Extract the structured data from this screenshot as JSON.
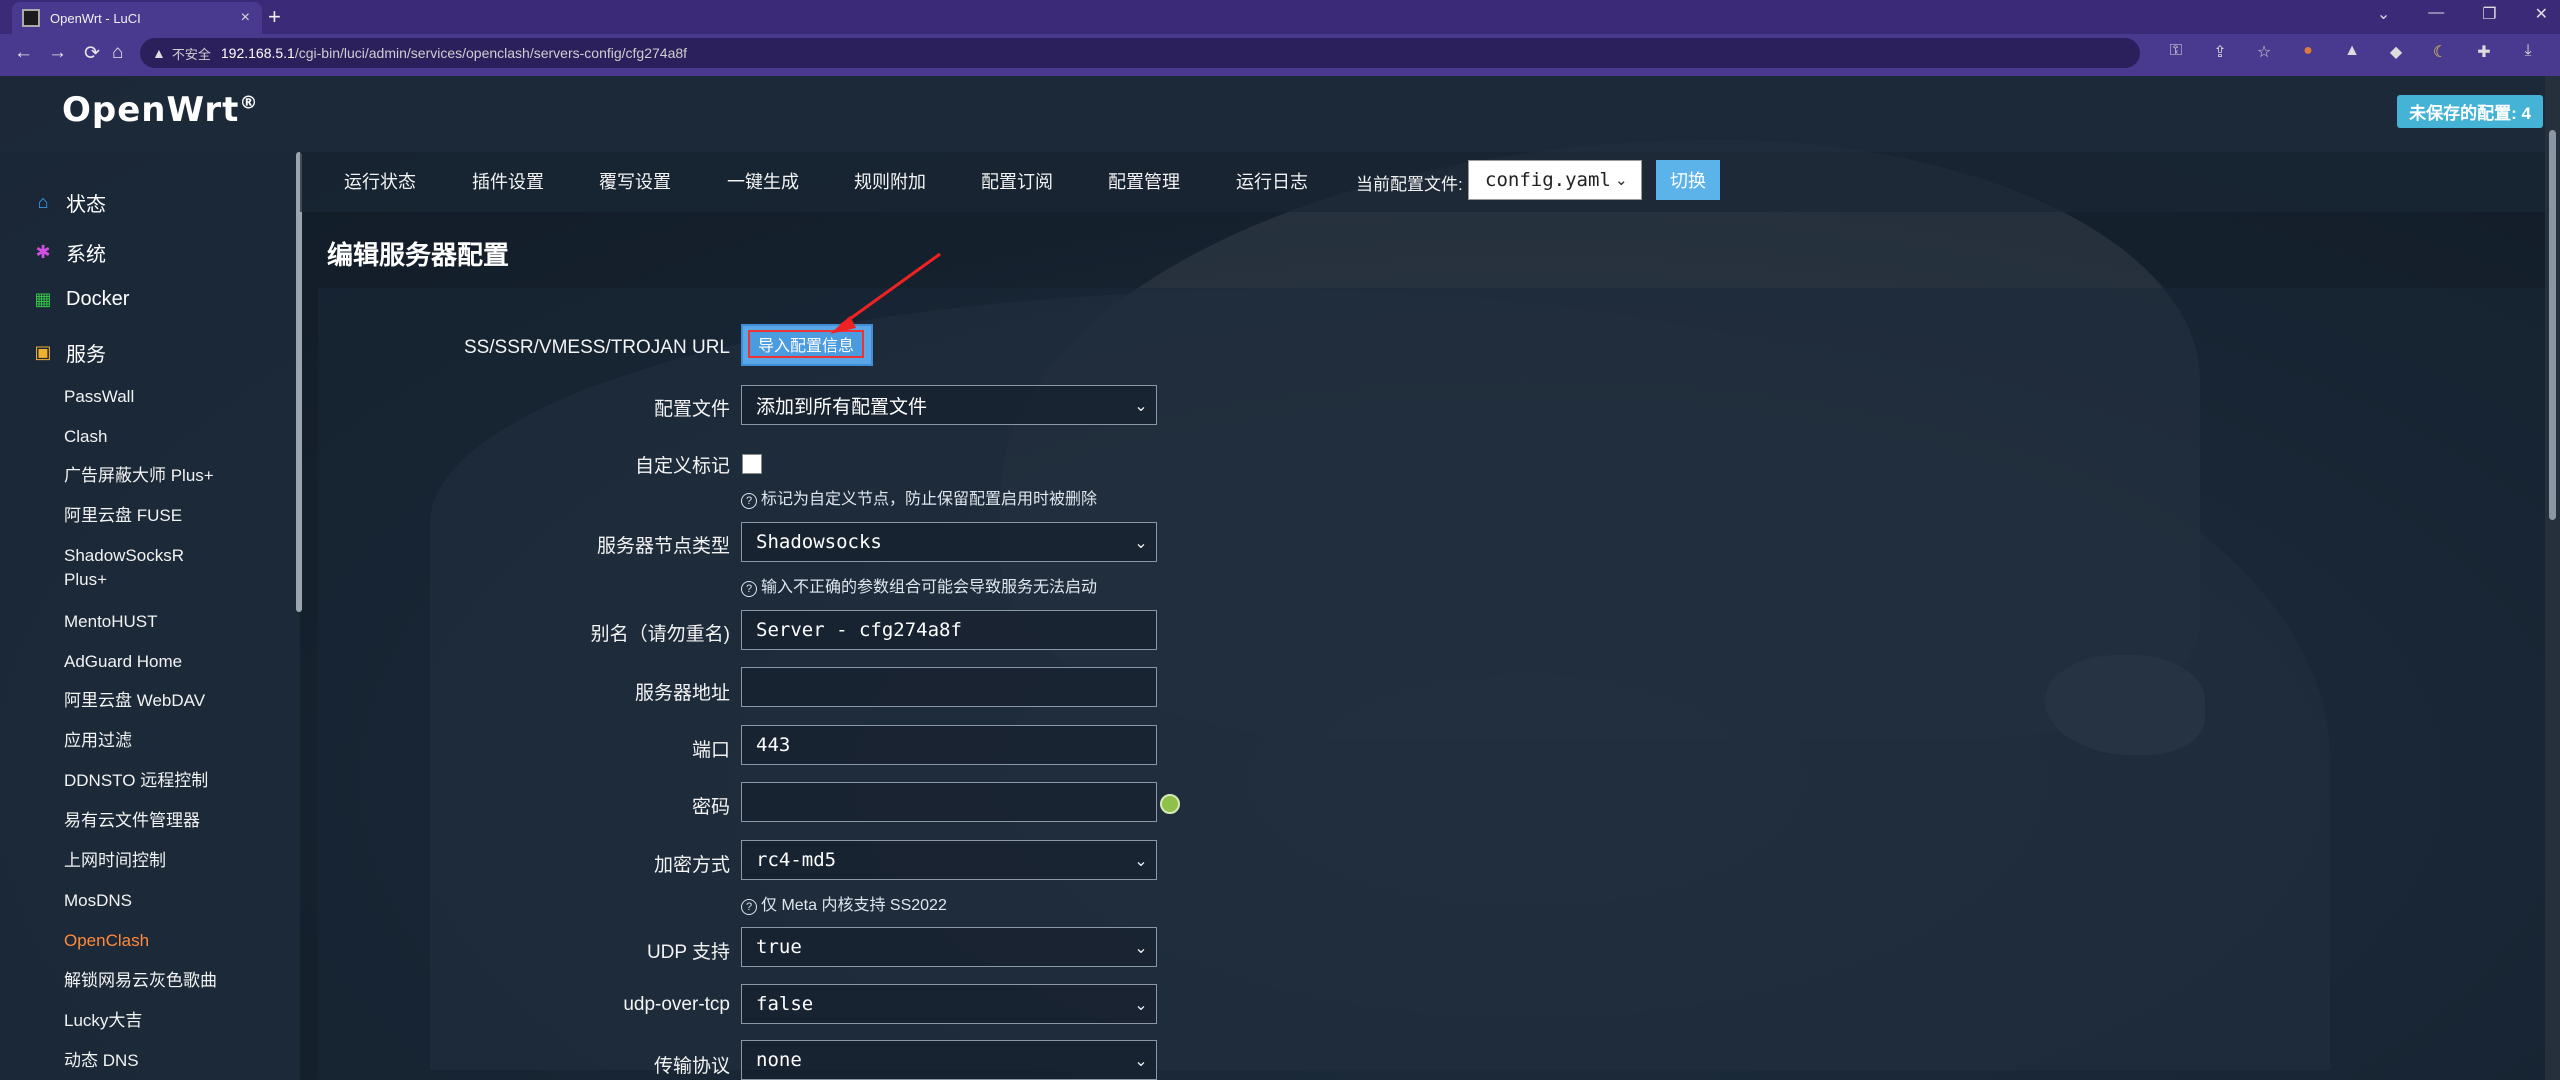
{
  "browser": {
    "tab_title": "OpenWrt - LuCI",
    "tab_close": "×",
    "new_tab": "+",
    "insecure_label": "不安全",
    "url_host": "192.168.5.1",
    "url_path": "/cgi-bin/luci/admin/services/openclash/servers-config/cfg274a8f",
    "window_controls": [
      "⌄",
      "—",
      "❐",
      "✕"
    ],
    "nav_icons": [
      "←",
      "→",
      "⟳",
      "⌂"
    ],
    "extension_icons": [
      "key-icon",
      "share-icon",
      "star-icon",
      "extension-1-icon",
      "extension-2-icon",
      "extension-3-icon",
      "moon-icon",
      "puzzle-icon",
      "download-icon",
      "sidepanel-icon",
      "profile-icon",
      "menu-icon"
    ]
  },
  "header": {
    "brand": "OpenWrt",
    "brand_mark": "®",
    "unsaved": "未保存的配置: 4"
  },
  "sidebar": {
    "top_items": [
      {
        "label": "状态",
        "icon": "home-icon",
        "color": "#3aa7ff"
      },
      {
        "label": "系统",
        "icon": "gear-icon",
        "color": "#d24ee0"
      },
      {
        "label": "Docker",
        "icon": "grid-icon",
        "color": "#35c24a"
      },
      {
        "label": "服务",
        "icon": "services-icon",
        "color": "#f0b030"
      }
    ],
    "sub_items": [
      "PassWall",
      "Clash",
      "广告屏蔽大师 Plus+",
      "阿里云盘 FUSE",
      "ShadowSocksR",
      "Plus+",
      "MentoHUST",
      "AdGuard Home",
      "阿里云盘 WebDAV",
      "应用过滤",
      "DDNSTO 远程控制",
      "易有云文件管理器",
      "上网时间控制",
      "MosDNS",
      "OpenClash",
      "解锁网易云灰色歌曲",
      "Lucky大吉",
      "动态 DNS"
    ],
    "active_item": "OpenClash"
  },
  "main_nav": {
    "tabs": [
      "运行状态",
      "插件设置",
      "覆写设置",
      "一键生成",
      "规则附加",
      "配置订阅",
      "配置管理",
      "运行日志"
    ],
    "current_config_label": "当前配置文件:",
    "current_config_value": "config.yaml",
    "switch_label": "切换"
  },
  "page_title": "编辑服务器配置",
  "form": {
    "import_label": "SS/SSR/VMESS/TROJAN URL",
    "import_button": "导入配置信息",
    "config_file_label": "配置文件",
    "config_file_value": "添加到所有配置文件",
    "custom_tag_label": "自定义标记",
    "custom_tag_help": "标记为自定义节点，防止保留配置启用时被删除",
    "node_type_label": "服务器节点类型",
    "node_type_value": "Shadowsocks",
    "node_type_help": "输入不正确的参数组合可能会导致服务无法启动",
    "alias_label": "别名（请勿重名)",
    "alias_value": "Server - cfg274a8f",
    "address_label": "服务器地址",
    "address_value": "",
    "port_label": "端口",
    "port_value": "443",
    "password_label": "密码",
    "password_value": "",
    "cipher_label": "加密方式",
    "cipher_value": "rc4-md5",
    "cipher_help": "仅 Meta 内核支持 SS2022",
    "udp_label": "UDP 支持",
    "udp_value": "true",
    "uot_label": "udp-over-tcp",
    "uot_value": "false",
    "transport_label": "传输协议",
    "transport_value": "none",
    "help_icon": "?",
    "chevron": "⌄"
  }
}
